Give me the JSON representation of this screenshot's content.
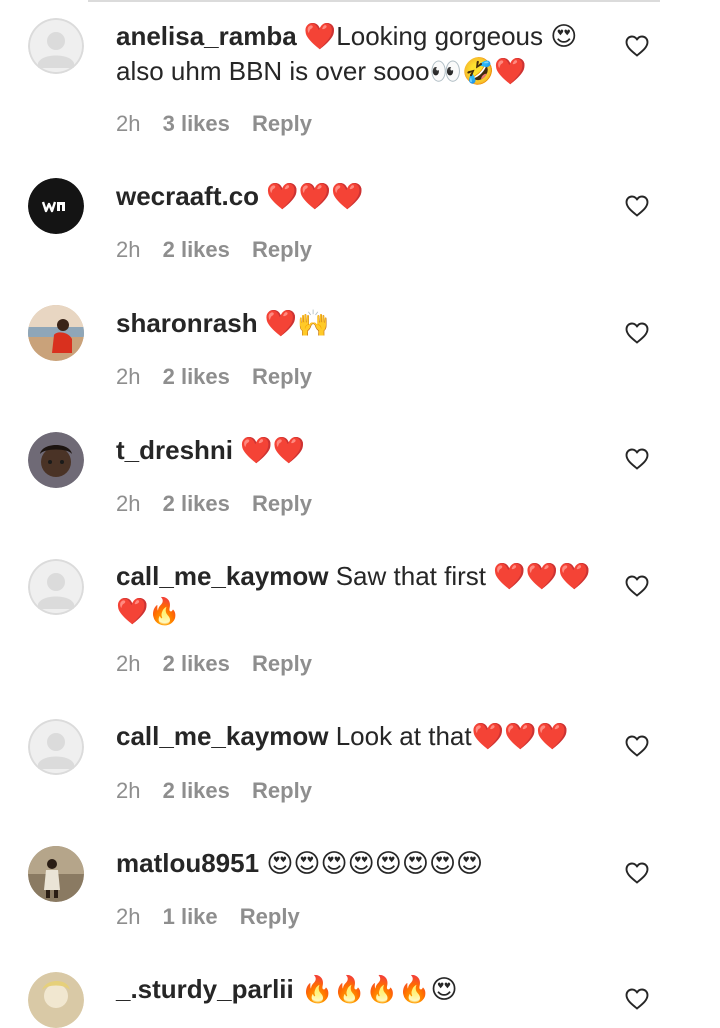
{
  "comments": [
    {
      "username": "anelisa_ramba",
      "text": "❤️Looking gorgeous 😍 also uhm BBN is over sooo👀🤣❤️",
      "time": "2h",
      "likes": "3 likes",
      "reply": "Reply",
      "avatar": "default-avatar"
    },
    {
      "username": "wecraaft.co",
      "text": "❤️❤️❤️",
      "time": "2h",
      "likes": "2 likes",
      "reply": "Reply",
      "avatar": "brand-logo-avatar"
    },
    {
      "username": "sharonrash",
      "text": "❤️🙌",
      "time": "2h",
      "likes": "2 likes",
      "reply": "Reply",
      "avatar": "photo-avatar"
    },
    {
      "username": "t_dreshni",
      "text": "❤️❤️",
      "time": "2h",
      "likes": "2 likes",
      "reply": "Reply",
      "avatar": "photo-avatar"
    },
    {
      "username": "call_me_kaymow",
      "text": "Saw that first ❤️❤️❤️❤️🔥",
      "time": "2h",
      "likes": "2 likes",
      "reply": "Reply",
      "avatar": "default-avatar"
    },
    {
      "username": "call_me_kaymow",
      "text": "Look at that❤️❤️❤️",
      "time": "2h",
      "likes": "2 likes",
      "reply": "Reply",
      "avatar": "default-avatar"
    },
    {
      "username": "matlou8951",
      "text": "😍😍😍😍😍😍😍😍",
      "time": "2h",
      "likes": "1 like",
      "reply": "Reply",
      "avatar": "photo-avatar"
    },
    {
      "username": "_.sturdy_parlii",
      "text": "🔥🔥🔥🔥😍",
      "time": "",
      "likes": "",
      "reply": "",
      "avatar": "photo-avatar"
    }
  ],
  "colors": {
    "text": "#262626",
    "meta": "#8e8e8e",
    "heart_red": "#ed1c24",
    "heart_outline": "#262626",
    "default_avatar_bg": "#dbdbdb"
  },
  "icons": {
    "like": "heart-outline-icon",
    "default_avatar": "user-silhouette-icon",
    "brand_avatar": "wecraaft-logo-icon"
  }
}
